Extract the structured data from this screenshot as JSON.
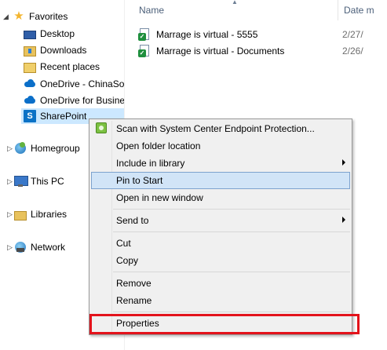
{
  "nav": {
    "favorites": "Favorites",
    "desktop": "Desktop",
    "downloads": "Downloads",
    "recent_places": "Recent places",
    "onedrive_chinasoft": "OneDrive - ChinaSof",
    "onedrive_business": "OneDrive for Busine",
    "sharepoint": "SharePoint",
    "homegroup": "Homegroup",
    "this_pc": "This PC",
    "libraries": "Libraries",
    "network": "Network"
  },
  "columns": {
    "name": "Name",
    "date": "Date m"
  },
  "files": [
    {
      "name": "Marrage is virtual - 5555",
      "date": "2/27/"
    },
    {
      "name": "Marrage is virtual - Documents",
      "date": "2/26/"
    }
  ],
  "context_menu": {
    "scan": "Scan with System Center Endpoint Protection...",
    "open_folder_location": "Open folder location",
    "include_in_library": "Include in library",
    "pin_to_start": "Pin to Start",
    "open_in_new_window": "Open in new window",
    "send_to": "Send to",
    "cut": "Cut",
    "copy": "Copy",
    "remove": "Remove",
    "rename": "Rename",
    "properties": "Properties"
  },
  "colors": {
    "selection": "#cce8ff",
    "menu_hover": "#d1e4f7",
    "annotation": "#e3131b"
  }
}
